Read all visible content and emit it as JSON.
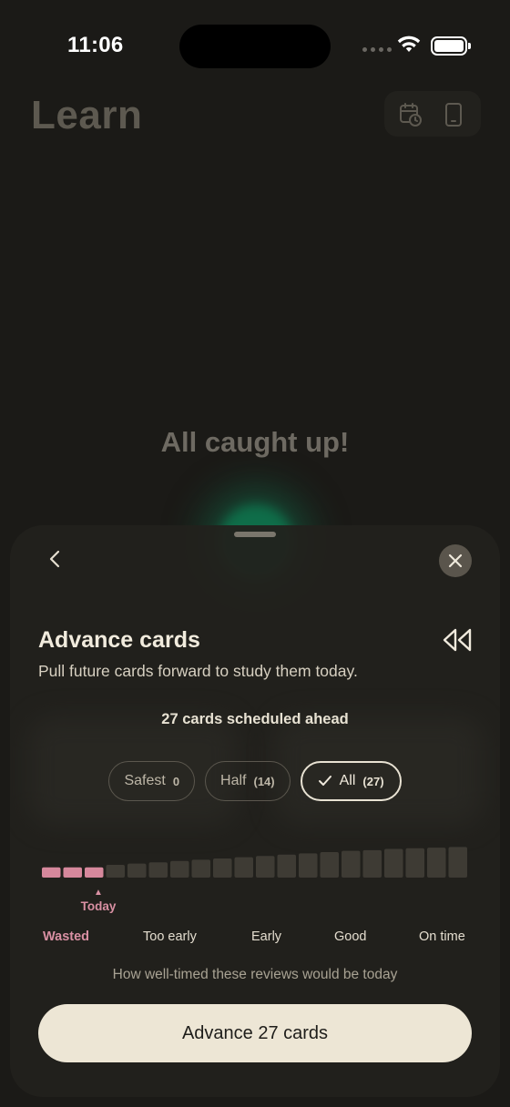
{
  "status_bar": {
    "time": "11:06"
  },
  "header": {
    "title": "Learn",
    "icons": [
      "calendar-clock-icon",
      "phone-icon"
    ]
  },
  "empty_state": {
    "message": "All caught up!"
  },
  "sheet": {
    "title": "Advance cards",
    "subtitle": "Pull future cards forward to study them today.",
    "scheduled_label": "27 cards scheduled ahead",
    "options": [
      {
        "label": "Safest",
        "count": "0",
        "selected": false
      },
      {
        "label": "Half",
        "count": "(14)",
        "selected": false
      },
      {
        "label": "All",
        "count": "(27)",
        "selected": true
      }
    ],
    "timeline": {
      "bar_levels": [
        0.32,
        0.32,
        0.32,
        0.4,
        0.44,
        0.48,
        0.52,
        0.56,
        0.6,
        0.64,
        0.68,
        0.72,
        0.76,
        0.8,
        0.84,
        0.86,
        0.9,
        0.92,
        0.94,
        0.96
      ],
      "highlighted_count": 3,
      "today_label": "Today",
      "colors": {
        "highlight": "#d6889c",
        "bar": "#3e3b34"
      }
    },
    "scale_labels": {
      "wasted": "Wasted",
      "too_early": "Too early",
      "early": "Early",
      "good": "Good",
      "on_time": "On time"
    },
    "hint": "How well-timed these reviews would be today",
    "cta_label": "Advance 27 cards"
  },
  "colors": {
    "accent_pink": "#d990a3",
    "glow_green": "#0f6d49",
    "cta_bg": "#ede6d5"
  }
}
